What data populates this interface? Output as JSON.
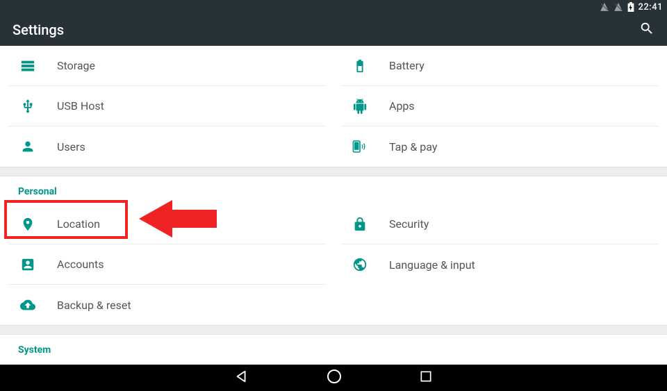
{
  "statusbar": {
    "time": "22:41"
  },
  "appbar": {
    "title": "Settings"
  },
  "group1": {
    "left": [
      {
        "icon": "storage",
        "label": "Storage"
      },
      {
        "icon": "usb",
        "label": "USB Host"
      },
      {
        "icon": "users",
        "label": "Users"
      }
    ],
    "right": [
      {
        "icon": "battery",
        "label": "Battery"
      },
      {
        "icon": "apps",
        "label": "Apps"
      },
      {
        "icon": "tap-pay",
        "label": "Tap & pay"
      }
    ]
  },
  "section_personal": "Personal",
  "group2": {
    "left": [
      {
        "icon": "location",
        "label": "Location"
      },
      {
        "icon": "accounts",
        "label": "Accounts"
      },
      {
        "icon": "backup",
        "label": "Backup & reset"
      }
    ],
    "right": [
      {
        "icon": "security",
        "label": "Security"
      },
      {
        "icon": "language",
        "label": "Language & input"
      }
    ]
  },
  "section_system": "System",
  "annotation": {
    "highlight_item": "Location"
  }
}
